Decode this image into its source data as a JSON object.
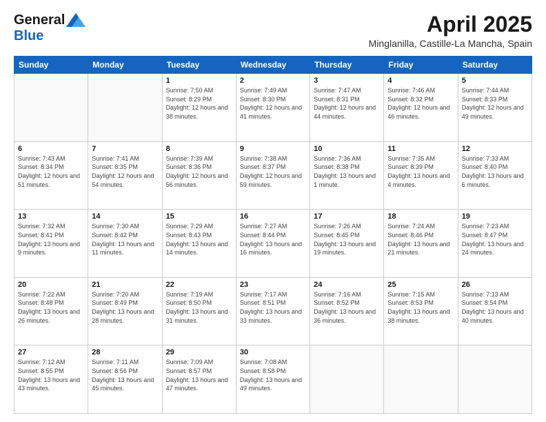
{
  "logo": {
    "line1": "General",
    "line2": "Blue"
  },
  "title": "April 2025",
  "subtitle": "Minglanilla, Castille-La Mancha, Spain",
  "days_header": [
    "Sunday",
    "Monday",
    "Tuesday",
    "Wednesday",
    "Thursday",
    "Friday",
    "Saturday"
  ],
  "weeks": [
    [
      {
        "num": "",
        "info": ""
      },
      {
        "num": "",
        "info": ""
      },
      {
        "num": "1",
        "info": "Sunrise: 7:50 AM\nSunset: 8:29 PM\nDaylight: 12 hours and 38 minutes."
      },
      {
        "num": "2",
        "info": "Sunrise: 7:49 AM\nSunset: 8:30 PM\nDaylight: 12 hours and 41 minutes."
      },
      {
        "num": "3",
        "info": "Sunrise: 7:47 AM\nSunset: 8:31 PM\nDaylight: 12 hours and 44 minutes."
      },
      {
        "num": "4",
        "info": "Sunrise: 7:46 AM\nSunset: 8:32 PM\nDaylight: 12 hours and 46 minutes."
      },
      {
        "num": "5",
        "info": "Sunrise: 7:44 AM\nSunset: 8:33 PM\nDaylight: 12 hours and 49 minutes."
      }
    ],
    [
      {
        "num": "6",
        "info": "Sunrise: 7:43 AM\nSunset: 8:34 PM\nDaylight: 12 hours and 51 minutes."
      },
      {
        "num": "7",
        "info": "Sunrise: 7:41 AM\nSunset: 8:35 PM\nDaylight: 12 hours and 54 minutes."
      },
      {
        "num": "8",
        "info": "Sunrise: 7:39 AM\nSunset: 8:36 PM\nDaylight: 12 hours and 56 minutes."
      },
      {
        "num": "9",
        "info": "Sunrise: 7:38 AM\nSunset: 8:37 PM\nDaylight: 12 hours and 59 minutes."
      },
      {
        "num": "10",
        "info": "Sunrise: 7:36 AM\nSunset: 8:38 PM\nDaylight: 13 hours and 1 minute."
      },
      {
        "num": "11",
        "info": "Sunrise: 7:35 AM\nSunset: 8:39 PM\nDaylight: 13 hours and 4 minutes."
      },
      {
        "num": "12",
        "info": "Sunrise: 7:33 AM\nSunset: 8:40 PM\nDaylight: 13 hours and 6 minutes."
      }
    ],
    [
      {
        "num": "13",
        "info": "Sunrise: 7:32 AM\nSunset: 8:41 PM\nDaylight: 13 hours and 9 minutes."
      },
      {
        "num": "14",
        "info": "Sunrise: 7:30 AM\nSunset: 8:42 PM\nDaylight: 13 hours and 11 minutes."
      },
      {
        "num": "15",
        "info": "Sunrise: 7:29 AM\nSunset: 8:43 PM\nDaylight: 13 hours and 14 minutes."
      },
      {
        "num": "16",
        "info": "Sunrise: 7:27 AM\nSunset: 8:44 PM\nDaylight: 13 hours and 16 minutes."
      },
      {
        "num": "17",
        "info": "Sunrise: 7:26 AM\nSunset: 8:45 PM\nDaylight: 13 hours and 19 minutes."
      },
      {
        "num": "18",
        "info": "Sunrise: 7:24 AM\nSunset: 8:46 PM\nDaylight: 13 hours and 21 minutes."
      },
      {
        "num": "19",
        "info": "Sunrise: 7:23 AM\nSunset: 8:47 PM\nDaylight: 13 hours and 24 minutes."
      }
    ],
    [
      {
        "num": "20",
        "info": "Sunrise: 7:22 AM\nSunset: 8:48 PM\nDaylight: 13 hours and 26 minutes."
      },
      {
        "num": "21",
        "info": "Sunrise: 7:20 AM\nSunset: 8:49 PM\nDaylight: 13 hours and 28 minutes."
      },
      {
        "num": "22",
        "info": "Sunrise: 7:19 AM\nSunset: 8:50 PM\nDaylight: 13 hours and 31 minutes."
      },
      {
        "num": "23",
        "info": "Sunrise: 7:17 AM\nSunset: 8:51 PM\nDaylight: 13 hours and 33 minutes."
      },
      {
        "num": "24",
        "info": "Sunrise: 7:16 AM\nSunset: 8:52 PM\nDaylight: 13 hours and 36 minutes."
      },
      {
        "num": "25",
        "info": "Sunrise: 7:15 AM\nSunset: 8:53 PM\nDaylight: 13 hours and 38 minutes."
      },
      {
        "num": "26",
        "info": "Sunrise: 7:13 AM\nSunset: 8:54 PM\nDaylight: 13 hours and 40 minutes."
      }
    ],
    [
      {
        "num": "27",
        "info": "Sunrise: 7:12 AM\nSunset: 8:55 PM\nDaylight: 13 hours and 43 minutes."
      },
      {
        "num": "28",
        "info": "Sunrise: 7:11 AM\nSunset: 8:56 PM\nDaylight: 13 hours and 45 minutes."
      },
      {
        "num": "29",
        "info": "Sunrise: 7:09 AM\nSunset: 8:57 PM\nDaylight: 13 hours and 47 minutes."
      },
      {
        "num": "30",
        "info": "Sunrise: 7:08 AM\nSunset: 8:58 PM\nDaylight: 13 hours and 49 minutes."
      },
      {
        "num": "",
        "info": ""
      },
      {
        "num": "",
        "info": ""
      },
      {
        "num": "",
        "info": ""
      }
    ]
  ]
}
